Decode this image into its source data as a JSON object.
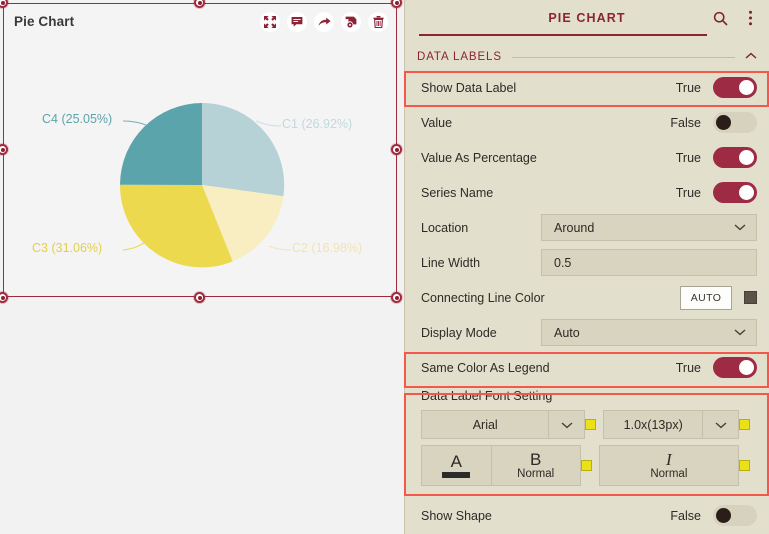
{
  "chart_card": {
    "title": "Pie Chart",
    "toolbar_icons": [
      "fullscreen-icon",
      "comment-icon",
      "share-icon",
      "save-icon",
      "delete-icon"
    ]
  },
  "chart_data": {
    "type": "pie",
    "title": "Pie Chart",
    "categories": [
      "C1",
      "C2",
      "C3",
      "C4"
    ],
    "values": [
      26.92,
      16.98,
      31.06,
      25.05
    ],
    "labels": [
      "C1 (26.92%)",
      "C2 (16.98%)",
      "C3 (31.06%)",
      "C4 (25.05%)"
    ],
    "colors": [
      "#b6d2d6",
      "#f8eec2",
      "#ecd94e",
      "#5ca4ab"
    ],
    "label_colors": [
      "#b6d2d6",
      "#f2e6b4",
      "#e5d25a",
      "#5ca4ab"
    ],
    "label_position": "Around",
    "legend_position": "none",
    "start_angle_deg": 0,
    "grid": false
  },
  "panel": {
    "title": "PIE CHART",
    "search_icon": "search-icon",
    "more_icon": "more-vertical-icon",
    "section": {
      "label": "DATA LABELS",
      "collapse_icon": "chevron-up-icon"
    },
    "rows": {
      "show_data_label": {
        "label": "Show Data Label",
        "value": "True",
        "state": "on"
      },
      "value": {
        "label": "Value",
        "value": "False",
        "state": "off"
      },
      "value_as_percentage": {
        "label": "Value As Percentage",
        "value": "True",
        "state": "on"
      },
      "series_name": {
        "label": "Series Name",
        "value": "True",
        "state": "on"
      },
      "location": {
        "label": "Location",
        "value": "Around"
      },
      "line_width": {
        "label": "Line Width",
        "value": "0.5"
      },
      "connecting_line_color": {
        "label": "Connecting Line Color",
        "button": "AUTO",
        "swatch": "#5b5248"
      },
      "display_mode": {
        "label": "Display Mode",
        "value": "Auto"
      },
      "same_color_as_legend": {
        "label": "Same Color As Legend",
        "value": "True",
        "state": "on"
      },
      "show_shape": {
        "label": "Show Shape",
        "value": "False",
        "state": "off"
      }
    },
    "font_setting": {
      "title": "Data Label Font Setting",
      "font_family": "Arial",
      "font_size": "1.0x(13px)",
      "underline_glyph": "A",
      "bold_glyph": "B",
      "bold_state": "Normal",
      "italic_glyph": "I",
      "italic_state": "Normal",
      "swatch_color": "#ece017"
    }
  },
  "theme": {
    "panel_bg": "#e2dfcd",
    "accent": "#8c2336",
    "toggle_on": "#9e2b44",
    "annotation": "#f4584c",
    "canvas_bg": "#f2f2f2",
    "card_bg": "#f4f4f4"
  }
}
